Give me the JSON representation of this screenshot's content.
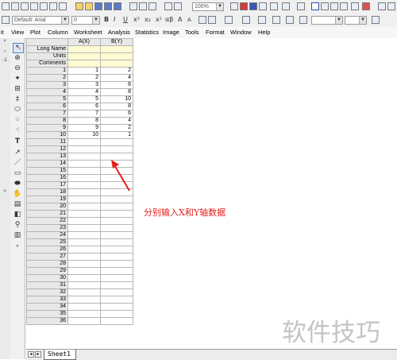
{
  "toolbar": {
    "font_combo": "Default: Arial",
    "size_combo": "0",
    "zoom": "100%",
    "format_buttons": [
      "B",
      "I",
      "U",
      "x²",
      "x₂",
      "x¹",
      "αβ",
      "A",
      "A"
    ]
  },
  "menu": {
    "items": [
      "it",
      "View",
      "Plot",
      "Column",
      "Worksheet",
      "Analysis",
      "Statistics",
      "Image",
      "Tools",
      "Format",
      "Window",
      "Help"
    ]
  },
  "sheet": {
    "col_headers": [
      "A(X)",
      "B(Y)"
    ],
    "meta_rows": [
      "Long Name",
      "Units",
      "Comments"
    ],
    "rows": [
      {
        "n": "1",
        "x": "1",
        "y": "2"
      },
      {
        "n": "2",
        "x": "2",
        "y": "4"
      },
      {
        "n": "3",
        "x": "3",
        "y": "6"
      },
      {
        "n": "4",
        "x": "4",
        "y": "8"
      },
      {
        "n": "5",
        "x": "5",
        "y": "10"
      },
      {
        "n": "6",
        "x": "6",
        "y": "8"
      },
      {
        "n": "7",
        "x": "7",
        "y": "6"
      },
      {
        "n": "8",
        "x": "8",
        "y": "4"
      },
      {
        "n": "9",
        "x": "9",
        "y": "2"
      },
      {
        "n": "10",
        "x": "10",
        "y": "1"
      },
      {
        "n": "11",
        "x": "",
        "y": ""
      },
      {
        "n": "12",
        "x": "",
        "y": ""
      },
      {
        "n": "13",
        "x": "",
        "y": ""
      },
      {
        "n": "14",
        "x": "",
        "y": ""
      },
      {
        "n": "15",
        "x": "",
        "y": ""
      },
      {
        "n": "16",
        "x": "",
        "y": ""
      },
      {
        "n": "17",
        "x": "",
        "y": ""
      },
      {
        "n": "18",
        "x": "",
        "y": ""
      },
      {
        "n": "19",
        "x": "",
        "y": ""
      },
      {
        "n": "20",
        "x": "",
        "y": ""
      },
      {
        "n": "21",
        "x": "",
        "y": ""
      },
      {
        "n": "22",
        "x": "",
        "y": ""
      },
      {
        "n": "23",
        "x": "",
        "y": ""
      },
      {
        "n": "24",
        "x": "",
        "y": ""
      },
      {
        "n": "25",
        "x": "",
        "y": ""
      },
      {
        "n": "26",
        "x": "",
        "y": ""
      },
      {
        "n": "27",
        "x": "",
        "y": ""
      },
      {
        "n": "28",
        "x": "",
        "y": ""
      },
      {
        "n": "29",
        "x": "",
        "y": ""
      },
      {
        "n": "30",
        "x": "",
        "y": ""
      },
      {
        "n": "31",
        "x": "",
        "y": ""
      },
      {
        "n": "32",
        "x": "",
        "y": ""
      },
      {
        "n": "33",
        "x": "",
        "y": ""
      },
      {
        "n": "34",
        "x": "",
        "y": ""
      },
      {
        "n": "35",
        "x": "",
        "y": ""
      },
      {
        "n": "36",
        "x": "",
        "y": ""
      }
    ],
    "tab_label": "Sheet1"
  },
  "annotation": {
    "text": "分别输入X和Y轴数据",
    "color": "#e81c1c"
  },
  "watermark": "软件技巧",
  "left_panel": [
    "×",
    "○",
    "-1",
    ">"
  ]
}
